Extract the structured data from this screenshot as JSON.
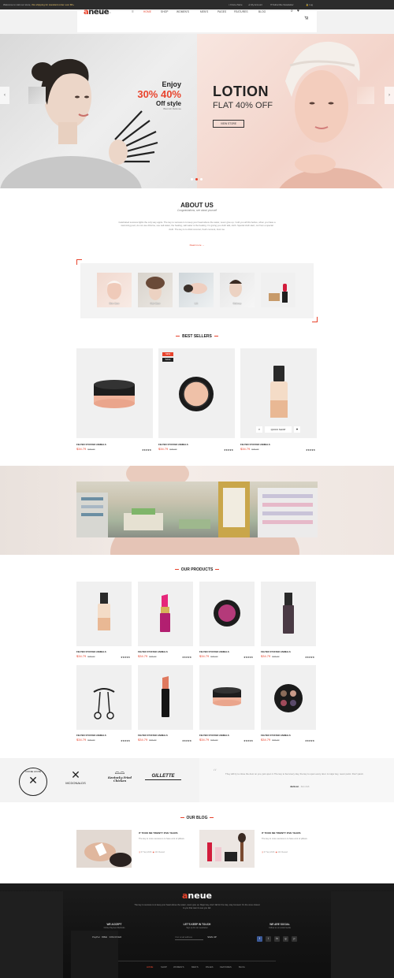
{
  "topbar": {
    "promo_prefix": "Welcome to visit our store,",
    "promo_highlight": "this shipping for standard order over $5+",
    "links": [
      "Find a Store",
      "My Account",
      "Subscribe Newsletter",
      "Log"
    ]
  },
  "header": {
    "logo_a": "a",
    "logo_rest": "neue",
    "logo_suffix": "™",
    "nav": [
      "HOME",
      "SHOP",
      "WOMEN'S",
      "MEN'S",
      "PAGES",
      "FEATURES",
      "BLOG"
    ],
    "cart_count": "0"
  },
  "hero": {
    "left": {
      "line1": "Enjoy",
      "line2": "30% 40%",
      "line3": "Off style",
      "line4": "Blemish Defense"
    },
    "right": {
      "title": "LOTION",
      "subtitle": "FLAT 40% OFF",
      "button": "VIEW STORE"
    }
  },
  "about": {
    "title": "ABOUT US",
    "subtitle": "Congratulations, see about yourself",
    "body": "Celebrated success lights the only way apple. The key to success is to keep your head above the water, never give up. I told you all this before, when you have a swimming pool, do not use chlorine, use salt water, the healing, salt water is the healing. I'm giving you cloth talk, cloth. Special cloth alert, cut from a special cloth. The key is to drink coconut, fresh coconut, trust me.",
    "read_more": "Read more"
  },
  "categories": [
    {
      "label": "Skin Care"
    },
    {
      "label": "Hair Care"
    },
    {
      "label": "Lift"
    },
    {
      "label": "Makeup"
    },
    {
      "label": ""
    }
  ],
  "best_sellers": {
    "title": "BEST SELLERS",
    "products": [
      {
        "name": "FELTED STUFFED ANIMALS",
        "price": "$34.79",
        "old_price": "$36.00",
        "stars": "★★★★★",
        "badges": []
      },
      {
        "name": "FELTED STUFFED ANIMALS",
        "price": "$34.79",
        "old_price": "$36.00",
        "stars": "★★★★★",
        "badges": [
          "NEW",
          "SALE"
        ]
      },
      {
        "name": "FELTED STUFFED ANIMALS",
        "price": "$34.79",
        "old_price": "$36.00",
        "stars": "★★★★★",
        "badges": [],
        "quick_shop": "QUICK SHOP"
      }
    ]
  },
  "our_products": {
    "title": "OUR PRODUCTS",
    "products": [
      {
        "name": "FELTED STUFFED ANIMALS",
        "price": "$34.79",
        "old_price": "$36.00",
        "stars": "★★★★★"
      },
      {
        "name": "FELTED STUFFED ANIMALS",
        "price": "$34.79",
        "old_price": "$36.00",
        "stars": "★★★★★"
      },
      {
        "name": "FELTED STUFFED ANIMALS",
        "price": "$34.79",
        "old_price": "$36.00",
        "stars": "★★★★★"
      },
      {
        "name": "FELTED STUFFED ANIMALS",
        "price": "$34.79",
        "old_price": "$36.00",
        "stars": "★★★★★"
      },
      {
        "name": "FELTED STUFFED ANIMALS",
        "price": "$34.79",
        "old_price": "$36.00",
        "stars": "★★★★★"
      },
      {
        "name": "FELTED STUFFED ANIMALS",
        "price": "$34.79",
        "old_price": "$36.00",
        "stars": "★★★★★"
      },
      {
        "name": "FELTED STUFFED ANIMALS",
        "price": "$34.79",
        "old_price": "$36.00",
        "stars": "★★★★★"
      },
      {
        "name": "FELTED STUFFED ANIMALS",
        "price": "$34.79",
        "old_price": "$36.00",
        "stars": "★★★★★"
      }
    ]
  },
  "brands": {
    "items": [
      "COFFEE HOUSE",
      "MCDONALDS",
      "Kentucky Fried Chicken",
      "GILLETTE"
    ],
    "testimonial_quote": "They will try to close the door on you, just open it. The key to fuel every day, the key to open every door. A major key, never panic. Don't panic.",
    "testimonial_author": "Jackson",
    "testimonial_role": "- Fan club"
  },
  "blog": {
    "title": "OUR BLOG",
    "posts": [
      {
        "title": "IT TOOK ME TWENTY FIVE YEARS",
        "body": "The key to more success is to have a lot of pillows.",
        "date": "07 Sep 2016",
        "views": "124 Viewed"
      },
      {
        "title": "IT TOOK ME TWENTY FIVE YEARS",
        "body": "The key to more success is to have a lot of pillows.",
        "date": "07 Sep 2016",
        "views": "124 Viewed"
      }
    ]
  },
  "footer": {
    "logo_a": "a",
    "logo_rest": "neue",
    "tagline": "The key to success is to keep your head above the water, never give up. Major key, don't fall for the trap, stay focused. It's the ones closest to you that want to see you fail.",
    "col1_title": "WE ACCEPT",
    "col1_sub": "Online Payment Methods",
    "payments": [
      "PayPal",
      "VISA",
      "DISCOVER"
    ],
    "col2_title": "LET'S KEEP IN TOUCH",
    "col2_sub": "Sign up for our newsletter",
    "newsletter_placeholder": "Your email address",
    "signup": "SIGN UP",
    "col3_title": "WE ARE SOCIAL",
    "col3_sub": "Follow us on social media",
    "social": [
      "f",
      "t",
      "in",
      "g",
      "p"
    ],
    "nav": [
      "HOME",
      "SHOP",
      "WOMEN'S",
      "MEN'S",
      "PAGES",
      "FEATURES",
      "BLOG"
    ]
  },
  "colors": {
    "accent": "#e8442d",
    "dark": "#222222",
    "footer_bg": "#161616"
  }
}
